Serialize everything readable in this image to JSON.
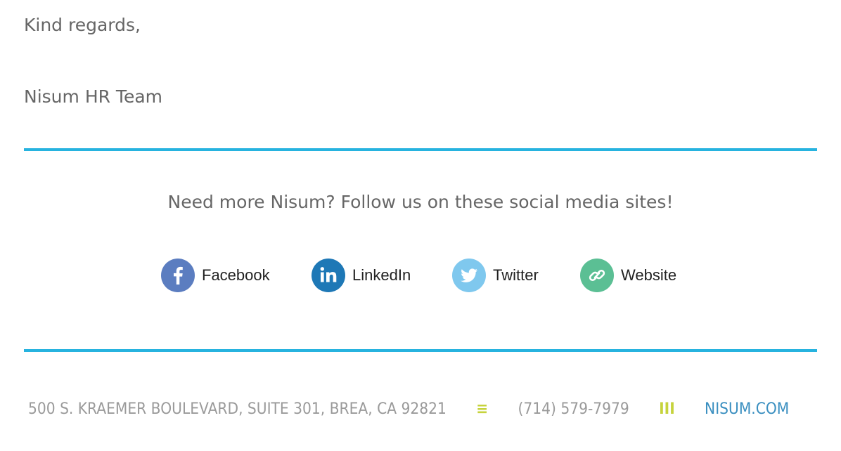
{
  "signoff": {
    "greeting": "Kind regards,",
    "team": "Nisum HR Team"
  },
  "follow": {
    "text": "Need more Nisum? Follow us on these social media sites!"
  },
  "social": [
    {
      "label": "Facebook",
      "icon": "facebook-icon",
      "color": "#5b7dc0"
    },
    {
      "label": "LinkedIn",
      "icon": "linkedin-icon",
      "color": "#1e78b6"
    },
    {
      "label": "Twitter",
      "icon": "twitter-icon",
      "color": "#7fc8ee"
    },
    {
      "label": "Website",
      "icon": "link-icon",
      "color": "#5bbf94"
    }
  ],
  "footer": {
    "address": "500 S. KRAEMER BOULEVARD, SUITE 301, BREA, CA 92821",
    "separator_1": "≡",
    "phone": "(714) 579-7979",
    "separator_2": "III",
    "website": "NISUM.COM"
  },
  "colors": {
    "rule": "#27b3df",
    "text": "#666666",
    "accent_separator": "#c6d33c",
    "link": "#3a8fc0"
  }
}
